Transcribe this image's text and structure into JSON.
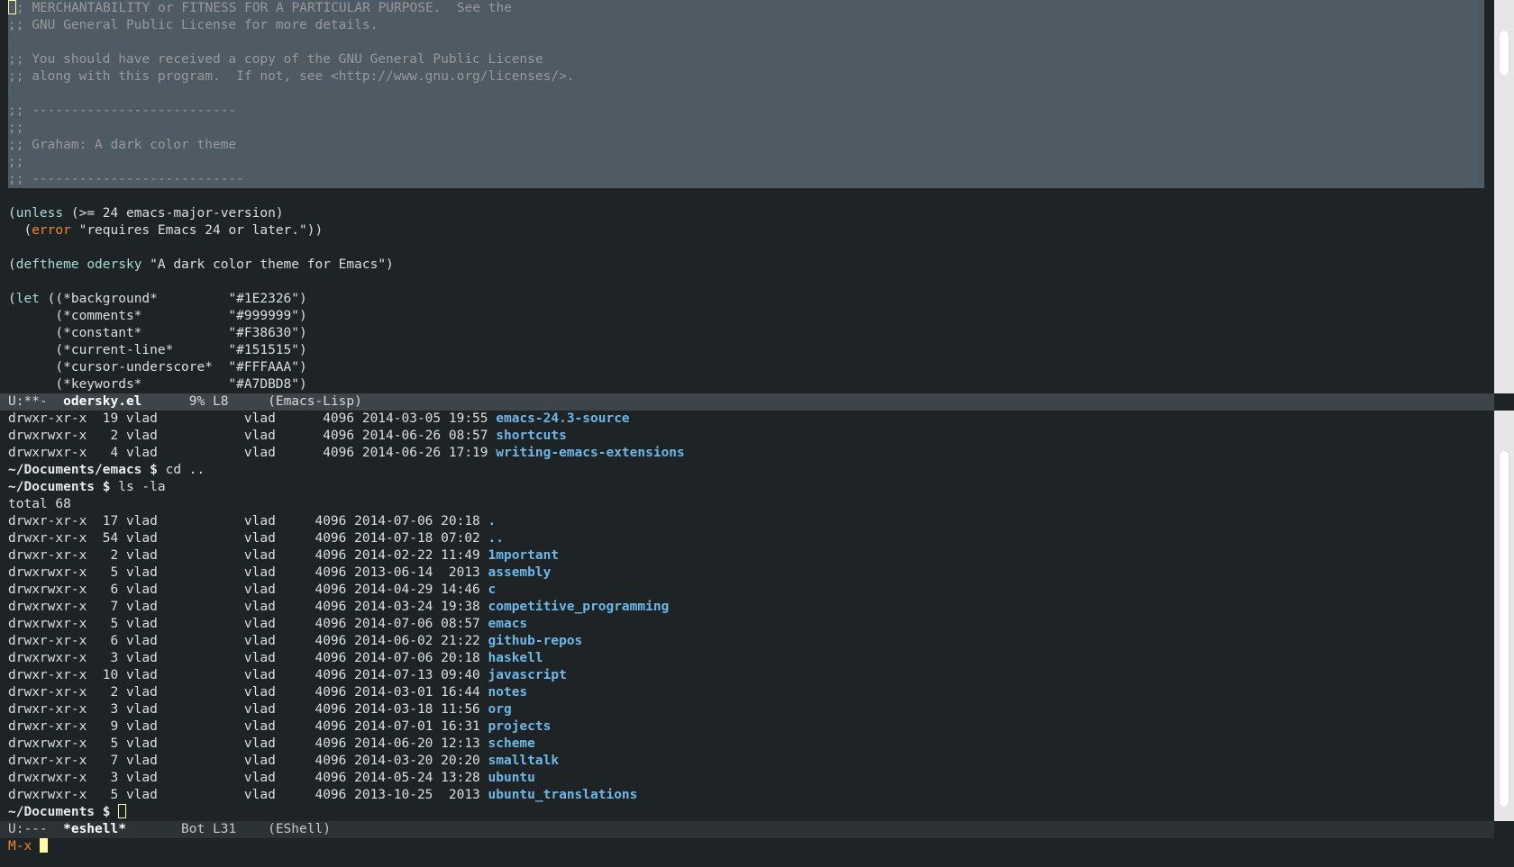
{
  "top_buffer": {
    "license_lines": [
      "; MERCHANTABILITY or FITNESS FOR A PARTICULAR PURPOSE.  See the",
      ";; GNU General Public License for more details.",
      "",
      ";; You should have received a copy of the GNU General Public License",
      ";; along with this program.  If not, see <http://www.gnu.org/licenses/>.",
      "",
      ";; --------------------------",
      ";;",
      ";; Graham: A dark color theme",
      ";;",
      ";; ---------------------------"
    ],
    "code": {
      "unless_open": "(",
      "unless_kw": "unless",
      "unless_rest": " (>= 24 emacs-major-version)",
      "error_indent": "  (",
      "error_kw": "error",
      "error_rest": " \"requires Emacs 24 or later.\"))",
      "deftheme_open": "(",
      "deftheme_kw": "deftheme",
      "deftheme_sp": " ",
      "deftheme_name": "odersky",
      "deftheme_rest": " \"A dark color theme for Emacs\")",
      "let_open": "(",
      "let_kw": "let",
      "let_rest": " ((*background*         \"#1E2326\")",
      "let_lines": [
        "      (*comments*           \"#999999\")",
        "      (*constant*           \"#F38630\")",
        "      (*current-line*       \"#151515\")",
        "      (*cursor-underscore*  \"#FFFAAA\")",
        "      (*keywords*           \"#A7DBD8\")"
      ]
    }
  },
  "modeline_top": {
    "status": "U:**-  ",
    "buffer": "odersky.el",
    "position": "      9% L8     ",
    "mode": "(Emacs-Lisp)"
  },
  "eshell": {
    "prev_listing": [
      {
        "info": "drwxr-xr-x  19 vlad           vlad      4096 2014-03-05 19:55 ",
        "name": "emacs-24.3-source"
      },
      {
        "info": "drwxrwxr-x   2 vlad           vlad      4096 2014-06-26 08:57 ",
        "name": "shortcuts"
      },
      {
        "info": "drwxrwxr-x   4 vlad           vlad      4096 2014-06-26 17:19 ",
        "name": "writing-emacs-extensions"
      }
    ],
    "prompt1": "~/Documents/emacs $ ",
    "cmd1": "cd ..",
    "prompt2": "~/Documents $ ",
    "cmd2": "ls -la",
    "total": "total 68",
    "listing": [
      {
        "info": "drwxr-xr-x  17 vlad           vlad     4096 2014-07-06 20:18 ",
        "name": "."
      },
      {
        "info": "drwxr-xr-x  54 vlad           vlad     4096 2014-07-18 07:02 ",
        "name": ".."
      },
      {
        "info": "drwxr-xr-x   2 vlad           vlad     4096 2014-02-22 11:49 ",
        "name": "1mportant"
      },
      {
        "info": "drwxrwxr-x   5 vlad           vlad     4096 2013-06-14  2013 ",
        "name": "assembly"
      },
      {
        "info": "drwxrwxr-x   6 vlad           vlad     4096 2014-04-29 14:46 ",
        "name": "c"
      },
      {
        "info": "drwxrwxr-x   7 vlad           vlad     4096 2014-03-24 19:38 ",
        "name": "competitive_programming"
      },
      {
        "info": "drwxrwxr-x   5 vlad           vlad     4096 2014-07-06 08:57 ",
        "name": "emacs"
      },
      {
        "info": "drwxr-xr-x   6 vlad           vlad     4096 2014-06-02 21:22 ",
        "name": "github-repos"
      },
      {
        "info": "drwxrwxr-x   3 vlad           vlad     4096 2014-07-06 20:18 ",
        "name": "haskell"
      },
      {
        "info": "drwxr-xr-x  10 vlad           vlad     4096 2014-07-13 09:40 ",
        "name": "javascript"
      },
      {
        "info": "drwxr-xr-x   2 vlad           vlad     4096 2014-03-01 16:44 ",
        "name": "notes"
      },
      {
        "info": "drwxr-xr-x   3 vlad           vlad     4096 2014-03-18 11:56 ",
        "name": "org"
      },
      {
        "info": "drwxr-xr-x   9 vlad           vlad     4096 2014-07-01 16:31 ",
        "name": "projects"
      },
      {
        "info": "drwxrwxr-x   5 vlad           vlad     4096 2014-06-20 12:13 ",
        "name": "scheme"
      },
      {
        "info": "drwxr-xr-x   7 vlad           vlad     4096 2014-03-20 20:20 ",
        "name": "smalltalk"
      },
      {
        "info": "drwxrwxr-x   3 vlad           vlad     4096 2014-05-24 13:28 ",
        "name": "ubuntu"
      },
      {
        "info": "drwxrwxr-x   5 vlad           vlad     4096 2013-10-25  2013 ",
        "name": "ubuntu_translations"
      }
    ],
    "prompt3": "~/Documents $ "
  },
  "modeline_bottom": {
    "status": "U:---  ",
    "buffer": "*eshell*",
    "position": "       Bot L31    ",
    "mode": "(EShell)"
  },
  "minibuffer": {
    "label": "M-x "
  },
  "colors": {
    "background": "#1E2326",
    "comments": "#999999",
    "constant": "#F38630",
    "cursor": "#FFFAAA",
    "keywords": "#A7DBD8"
  }
}
